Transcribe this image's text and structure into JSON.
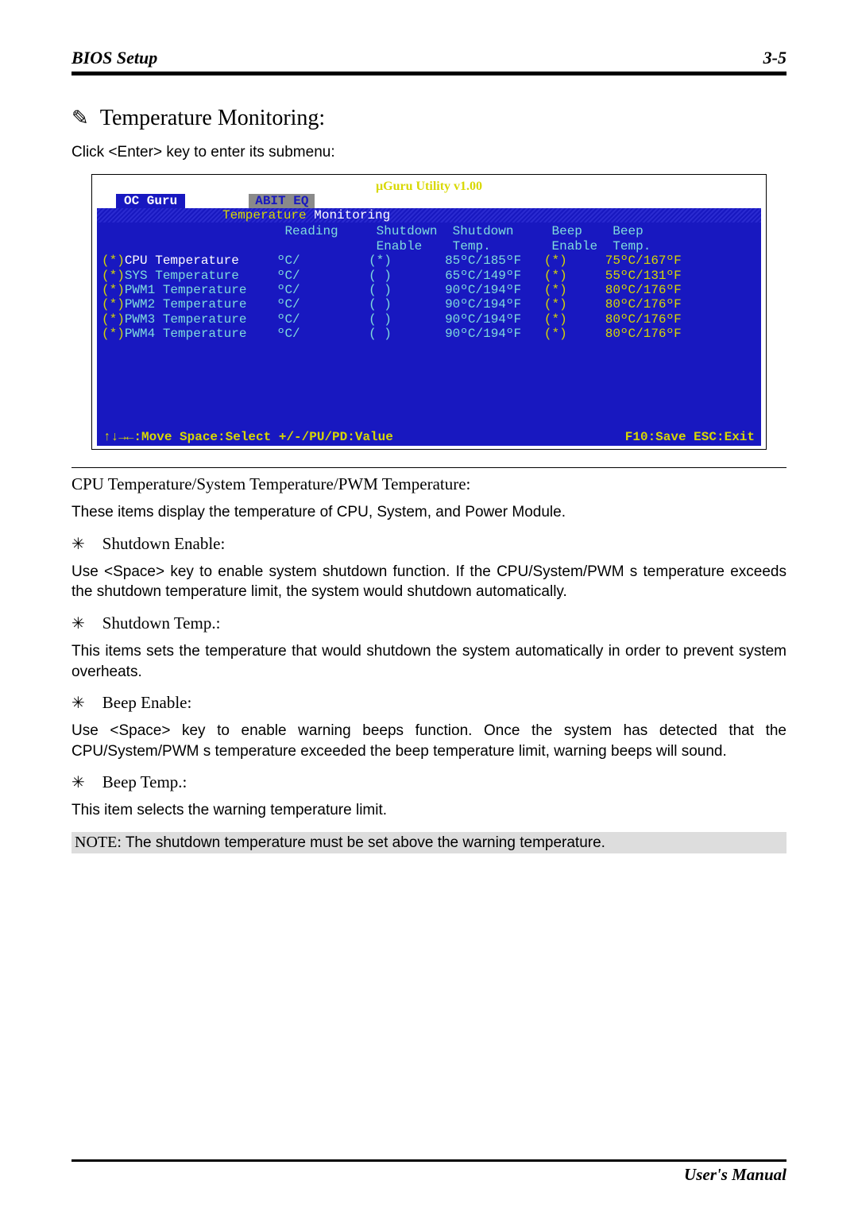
{
  "page": {
    "header_left": "BIOS Setup",
    "header_right": "3-5",
    "footer": "User's Manual"
  },
  "section": {
    "title": "Temperature Monitoring:",
    "intro": "Click <Enter> key to enter its submenu:"
  },
  "bios": {
    "title": "µGuru Utility v1.00",
    "tab_active": "OC Guru",
    "tab_inactive": "ABIT EQ",
    "sub_left": "Temperature",
    "sub_right": "Monitoring",
    "col_reading": "Reading",
    "col_shutdown_enable1": "Shutdown",
    "col_shutdown_enable2": "Enable",
    "col_shutdown_temp1": "Shutdown",
    "col_shutdown_temp2": "Temp.",
    "col_beep_enable1": "Beep",
    "col_beep_enable2": "Enable",
    "col_beep_temp1": "Beep",
    "col_beep_temp2": "Temp.",
    "rows": [
      {
        "mark": "(*)",
        "name": "CPU Temperature",
        "reading": "ºC/",
        "se": "(*)",
        "stemp": "85ºC/185ºF",
        "be": "(*)",
        "btemp": "75ºC/167ºF"
      },
      {
        "mark": "(*)",
        "name": "SYS Temperature",
        "reading": "ºC/",
        "se": "( )",
        "stemp": "65ºC/149ºF",
        "be": "(*)",
        "btemp": "55ºC/131ºF"
      },
      {
        "mark": "(*)",
        "name": "PWM1 Temperature",
        "reading": "ºC/",
        "se": "( )",
        "stemp": "90ºC/194ºF",
        "be": "(*)",
        "btemp": "80ºC/176ºF"
      },
      {
        "mark": "(*)",
        "name": "PWM2 Temperature",
        "reading": "ºC/",
        "se": "( )",
        "stemp": "90ºC/194ºF",
        "be": "(*)",
        "btemp": "80ºC/176ºF"
      },
      {
        "mark": "(*)",
        "name": "PWM3 Temperature",
        "reading": "ºC/",
        "se": "( )",
        "stemp": "90ºC/194ºF",
        "be": "(*)",
        "btemp": "80ºC/176ºF"
      },
      {
        "mark": "(*)",
        "name": "PWM4 Temperature",
        "reading": "ºC/",
        "se": "( )",
        "stemp": "90ºC/194ºF",
        "be": "(*)",
        "btemp": "80ºC/176ºF"
      }
    ],
    "footer_left": "↑↓→←:Move  Space:Select  +/-/PU/PD:Value",
    "footer_right": "F10:Save  ESC:Exit"
  },
  "desc": {
    "h1": "CPU Temperature/System Temperature/PWM Temperature:",
    "p1": "These items display the temperature of CPU, System, and Power Module.",
    "b1": "Shutdown Enable:",
    "p2": "Use <Space> key to enable system shutdown function. If the CPU/System/PWM s temperature exceeds the shutdown temperature limit, the system would shutdown automatically.",
    "b2": "Shutdown Temp.:",
    "p3": "This items sets the temperature that would shutdown the system automatically in order to prevent system overheats.",
    "b3": "Beep Enable:",
    "p4": "Use <Space> key to enable warning beeps function. Once the system has detected that the CPU/System/PWM s temperature exceeded the beep temperature limit, warning beeps will sound.",
    "b4": "Beep Temp.:",
    "p5": "This item selects the warning temperature limit.",
    "note_label": "NOTE:",
    "note_text": " The shutdown temperature must be set above the warning temperature."
  }
}
